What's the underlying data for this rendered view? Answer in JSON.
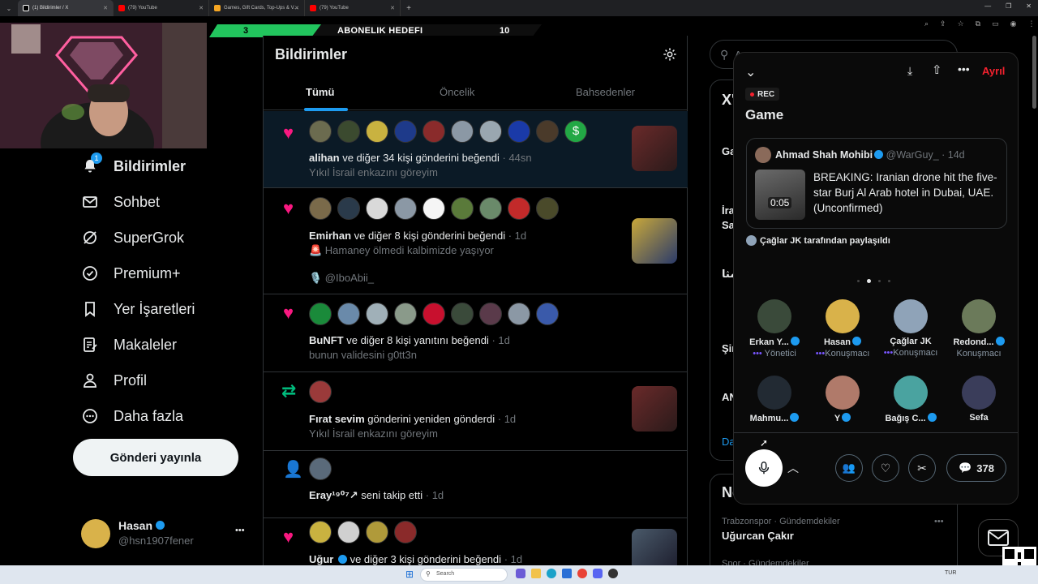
{
  "browser": {
    "tabs": [
      {
        "title": "(1) Bildirimler / X",
        "active": true,
        "color": "#ffffff"
      },
      {
        "title": "(79) YouTube",
        "active": false,
        "color": "#ff0000"
      },
      {
        "title": "Games, Gift Cards, Top-Ups & V...",
        "active": false,
        "color": "#f5a623"
      },
      {
        "title": "(79) YouTube",
        "active": false,
        "color": "#ff0000"
      }
    ],
    "new_tab": "+"
  },
  "subscription_goal": {
    "current": "3",
    "label": "ABONELIK HEDEFI",
    "target": "10"
  },
  "nav": {
    "badge": "1",
    "items": [
      {
        "label": "Bildirimler",
        "icon": "bell-icon",
        "bold": true
      },
      {
        "label": "Sohbet",
        "icon": "mail-icon"
      },
      {
        "label": "SuperGrok",
        "icon": "grok-icon"
      },
      {
        "label": "Premium+",
        "icon": "verified-icon"
      },
      {
        "label": "Yer İşaretleri",
        "icon": "bookmark-icon"
      },
      {
        "label": "Makaleler",
        "icon": "article-icon"
      },
      {
        "label": "Profil",
        "icon": "person-icon"
      },
      {
        "label": "Daha fazla",
        "icon": "more-circle-icon"
      }
    ],
    "post_button": "Gönderi yayınla",
    "account": {
      "name": "Hasan",
      "handle": "@hsn1907fener",
      "more": "•••"
    }
  },
  "header": {
    "title": "Bildirimler",
    "tabs": [
      "Tümü",
      "Öncelik",
      "Bahsedenler"
    ],
    "active_tab": 0
  },
  "notifications": [
    {
      "type": "like",
      "user": "alihan",
      "rest": "ve diğer 34 kişi gönderini beğendi",
      "time": "· 44sn",
      "sub": "Yıkıl İsrail enkazını göreyim",
      "avatars": 10,
      "thumb": true
    },
    {
      "type": "like",
      "user": "Emirhan",
      "rest": "ve diğer 8 kişi gönderini beğendi",
      "time": "· 1d",
      "sub": "🚨 Hamaney ölmedi kalbimizde yaşıyor",
      "sub2": "🎙️ @IboAbii_",
      "avatars": 9,
      "thumb": true
    },
    {
      "type": "like",
      "user": "BuNFT",
      "rest": "ve diğer 8 kişi yanıtını beğendi",
      "time": "· 1d",
      "sub": "bunun validesini g0tt3n",
      "avatars": 9,
      "thumb": false
    },
    {
      "type": "repost",
      "user": "Fırat sevim",
      "rest": "gönderini yeniden gönderdi",
      "time": "· 1d",
      "sub": "Yıkıl İsrail enkazını göreyim",
      "avatars": 1,
      "thumb": true
    },
    {
      "type": "follow",
      "user": "Eray¹⁹⁰⁷↗",
      "rest": "seni takip etti",
      "time": "· 1d",
      "sub": "",
      "avatars": 1,
      "thumb": false
    },
    {
      "type": "like",
      "user": "Uğur",
      "rest": "ve diğer 3 kişi gönderini beğendi",
      "time": "· 1d",
      "sub": "",
      "avatars": 4,
      "thumb": true
    }
  ],
  "search_placeholder": "A",
  "right_column": {
    "partial": [
      "X'",
      "Ga",
      "İra",
      "Sa",
      "مثا",
      "Şir",
      "AN",
      "Da",
      "No"
    ],
    "trend_meta": "Trabzonspor · Gündemdekiler",
    "trend_title": "Uğurcan Çakır",
    "trend_meta2": "Spor · Gündemdekiler"
  },
  "space": {
    "leave": "Ayrıl",
    "rec": "REC",
    "title": "Game",
    "tweet": {
      "author": "Ahmad Shah Mohibi",
      "handle": "@WarGuy_",
      "time": "· 14d",
      "text": "BREAKING: Iranian drone hit the five-star Burj Al Arab hotel in Dubai, UAE. (Unconfirmed)",
      "duration": "0:05"
    },
    "shared_by": "Çağlar JK tarafından paylaşıldı",
    "speakers": [
      {
        "name": "Erkan Y...",
        "role": "Yönetici",
        "verified": true,
        "color": "#3a4a3a"
      },
      {
        "name": "Hasan",
        "role": "Konuşmacı",
        "verified": true,
        "color": "#d9b24a"
      },
      {
        "name": "Çağlar JK",
        "role": "Konuşmacı",
        "verified": false,
        "color": "#8fa3b8"
      },
      {
        "name": "Redond...",
        "role": "Konuşmacı",
        "verified": true,
        "color": "#6b7a5a"
      },
      {
        "name": "Mahmu...",
        "role": "",
        "verified": true,
        "color": "#222a33"
      },
      {
        "name": "Y",
        "role": "",
        "verified": true,
        "color": "#b07a6a"
      },
      {
        "name": "Bağış C...",
        "role": "",
        "verified": true,
        "color": "#4aa3a0"
      },
      {
        "name": "Sefa",
        "role": "",
        "verified": false,
        "color": "#3a3d5a"
      }
    ],
    "reply_count": "378"
  },
  "taskbar": {
    "search": "Search",
    "lang": "TUR"
  }
}
